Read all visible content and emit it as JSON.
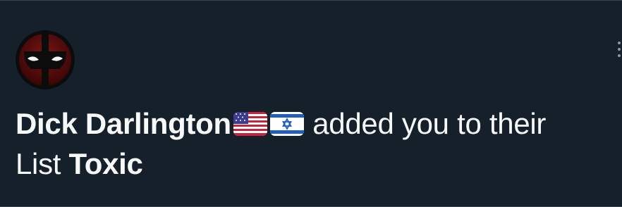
{
  "notification": {
    "user_name": "Dick Darlington",
    "flags": [
      "us-flag",
      "israel-flag"
    ],
    "action_text": " added you to their",
    "list_word": "List ",
    "list_name": "Toxic",
    "avatar_icon": "deadpool-mask-icon",
    "more_icon": "more-options-icon"
  },
  "colors": {
    "background": "#15202b",
    "text": "#f7f9f9",
    "divider": "#38444d",
    "muted": "#8b98a5"
  }
}
